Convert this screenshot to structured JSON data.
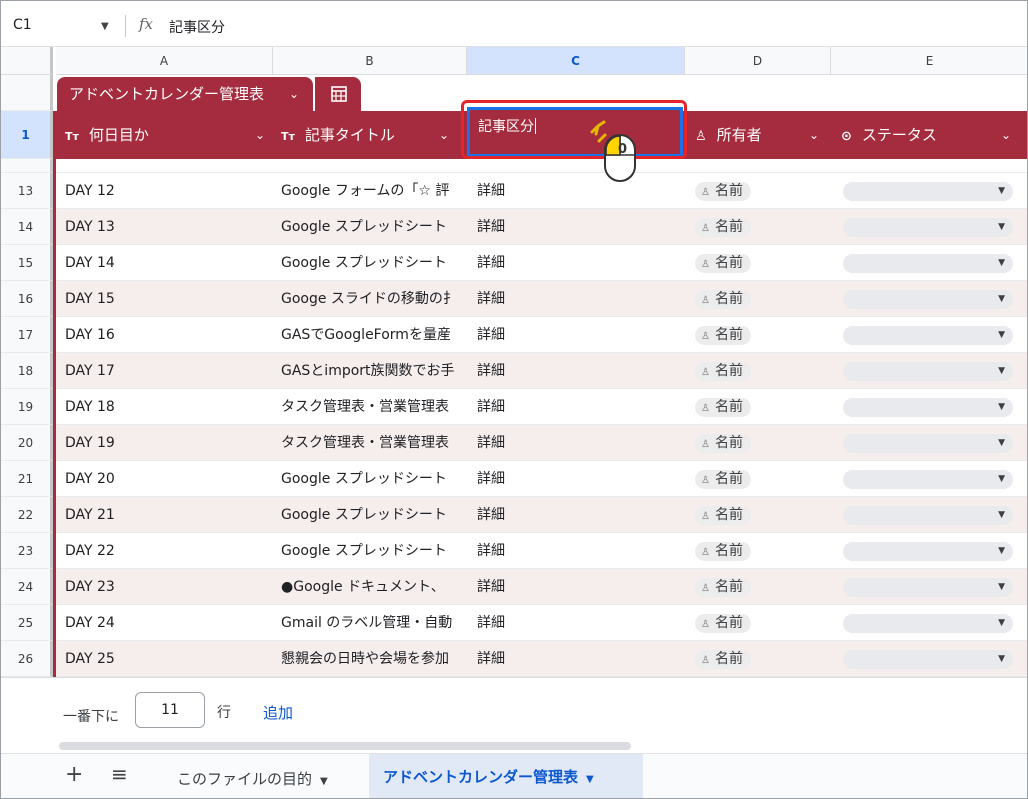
{
  "formula_bar": {
    "cell_ref": "C1",
    "fx": "fx",
    "value": "記事区分"
  },
  "columns": [
    {
      "letter": "A",
      "selected": false
    },
    {
      "letter": "B",
      "selected": false
    },
    {
      "letter": "C",
      "selected": true
    },
    {
      "letter": "D",
      "selected": false
    },
    {
      "letter": "E",
      "selected": false
    }
  ],
  "table": {
    "name": "アドベントカレンダー管理表",
    "header_row_num": "1",
    "headers": {
      "a": {
        "icon": "Tт",
        "label": "何日目か"
      },
      "b": {
        "icon": "Tт",
        "label": "記事タイトル"
      },
      "c": {
        "label": "記事区分"
      },
      "d": {
        "icon": "person-icon",
        "label": "所有者"
      },
      "e": {
        "icon": "dropdown-icon",
        "label": "ステータス"
      }
    }
  },
  "rows": [
    {
      "num": "13",
      "day": "DAY 12",
      "title": "Google フォームの「☆ 評",
      "kind": "詳細",
      "owner": "名前"
    },
    {
      "num": "14",
      "day": "DAY 13",
      "title": "Google スプレッドシート",
      "kind": "詳細",
      "owner": "名前"
    },
    {
      "num": "15",
      "day": "DAY 14",
      "title": "Google スプレッドシート",
      "kind": "詳細",
      "owner": "名前"
    },
    {
      "num": "16",
      "day": "DAY 15",
      "title": "Googe スライドの移動の扌",
      "kind": "詳細",
      "owner": "名前"
    },
    {
      "num": "17",
      "day": "DAY 16",
      "title": "GASでGoogleFormを量産",
      "kind": "詳細",
      "owner": "名前"
    },
    {
      "num": "18",
      "day": "DAY 17",
      "title": "GASとimport族関数でお手",
      "kind": "詳細",
      "owner": "名前"
    },
    {
      "num": "19",
      "day": "DAY 18",
      "title": "タスク管理表・営業管理表",
      "kind": "詳細",
      "owner": "名前"
    },
    {
      "num": "20",
      "day": "DAY 19",
      "title": "タスク管理表・営業管理表",
      "kind": "詳細",
      "owner": "名前"
    },
    {
      "num": "21",
      "day": "DAY 20",
      "title": "Google スプレッドシート",
      "kind": "詳細",
      "owner": "名前"
    },
    {
      "num": "22",
      "day": "DAY 21",
      "title": "Google スプレッドシート",
      "kind": "詳細",
      "owner": "名前"
    },
    {
      "num": "23",
      "day": "DAY 22",
      "title": "Google スプレッドシート",
      "kind": "詳細",
      "owner": "名前"
    },
    {
      "num": "24",
      "day": "DAY 23",
      "title": "●Google ドキュメント、",
      "kind": "詳細",
      "owner": "名前"
    },
    {
      "num": "25",
      "day": "DAY 24",
      "title": "Gmail のラベル管理・自動",
      "kind": "詳細",
      "owner": "名前"
    },
    {
      "num": "26",
      "day": "DAY 25",
      "title": "懇親会の日時や会場を参加",
      "kind": "詳細",
      "owner": "名前"
    }
  ],
  "footer": {
    "prefix": "一番下に",
    "count": "11",
    "suffix": "行",
    "add_label": "追加"
  },
  "sheet_tabs": {
    "add": "+",
    "menu": "≡",
    "tabs": [
      {
        "label": "このファイルの目的",
        "active": false
      },
      {
        "label": "アドベントカレンダー管理表",
        "active": true
      }
    ]
  },
  "cursor": {
    "click_label": "0"
  },
  "colors": {
    "table_header": "#a52c3e",
    "highlight": "#e5252a",
    "selection": "#d3e3fd",
    "link": "#0b57d0"
  }
}
